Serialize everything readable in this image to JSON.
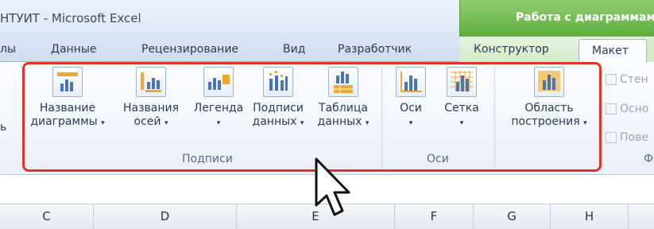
{
  "window": {
    "title": "НТУИТ  -  Microsoft Excel",
    "context_group": "Работа с диаграммами"
  },
  "tabs": {
    "items": [
      "лы",
      "Данные",
      "Рецензирование",
      "Вид",
      "Разработчик",
      "Конструктор",
      "Макет"
    ],
    "active": "Макет"
  },
  "ribbon": {
    "partial_left_label": "ь",
    "buttons": [
      {
        "line1": "Название",
        "line2": "диаграммы",
        "icon": "chart-title-icon"
      },
      {
        "line1": "Названия",
        "line2": "осей",
        "icon": "axis-titles-icon"
      },
      {
        "line1": "Легенда",
        "line2": "",
        "icon": "legend-icon"
      },
      {
        "line1": "Подписи",
        "line2": "данных",
        "icon": "data-labels-icon"
      },
      {
        "line1": "Таблица",
        "line2": "данных",
        "icon": "data-table-icon"
      },
      {
        "line1": "Оси",
        "line2": "",
        "icon": "axes-icon"
      },
      {
        "line1": "Сетка",
        "line2": "",
        "icon": "gridlines-icon"
      },
      {
        "line1": "Область",
        "line2": "построения",
        "icon": "plot-area-icon"
      }
    ],
    "groups": [
      "Подписи",
      "Оси",
      "Ф"
    ],
    "side_buttons": [
      "Стен",
      "Осно",
      "Пове"
    ],
    "dropdown_arrow": "▾"
  },
  "sheet": {
    "columns": [
      "C",
      "D",
      "E",
      "F",
      "G",
      "H"
    ]
  },
  "colors": {
    "highlight": "#e0342b",
    "context_tab": "#5fae3f"
  }
}
